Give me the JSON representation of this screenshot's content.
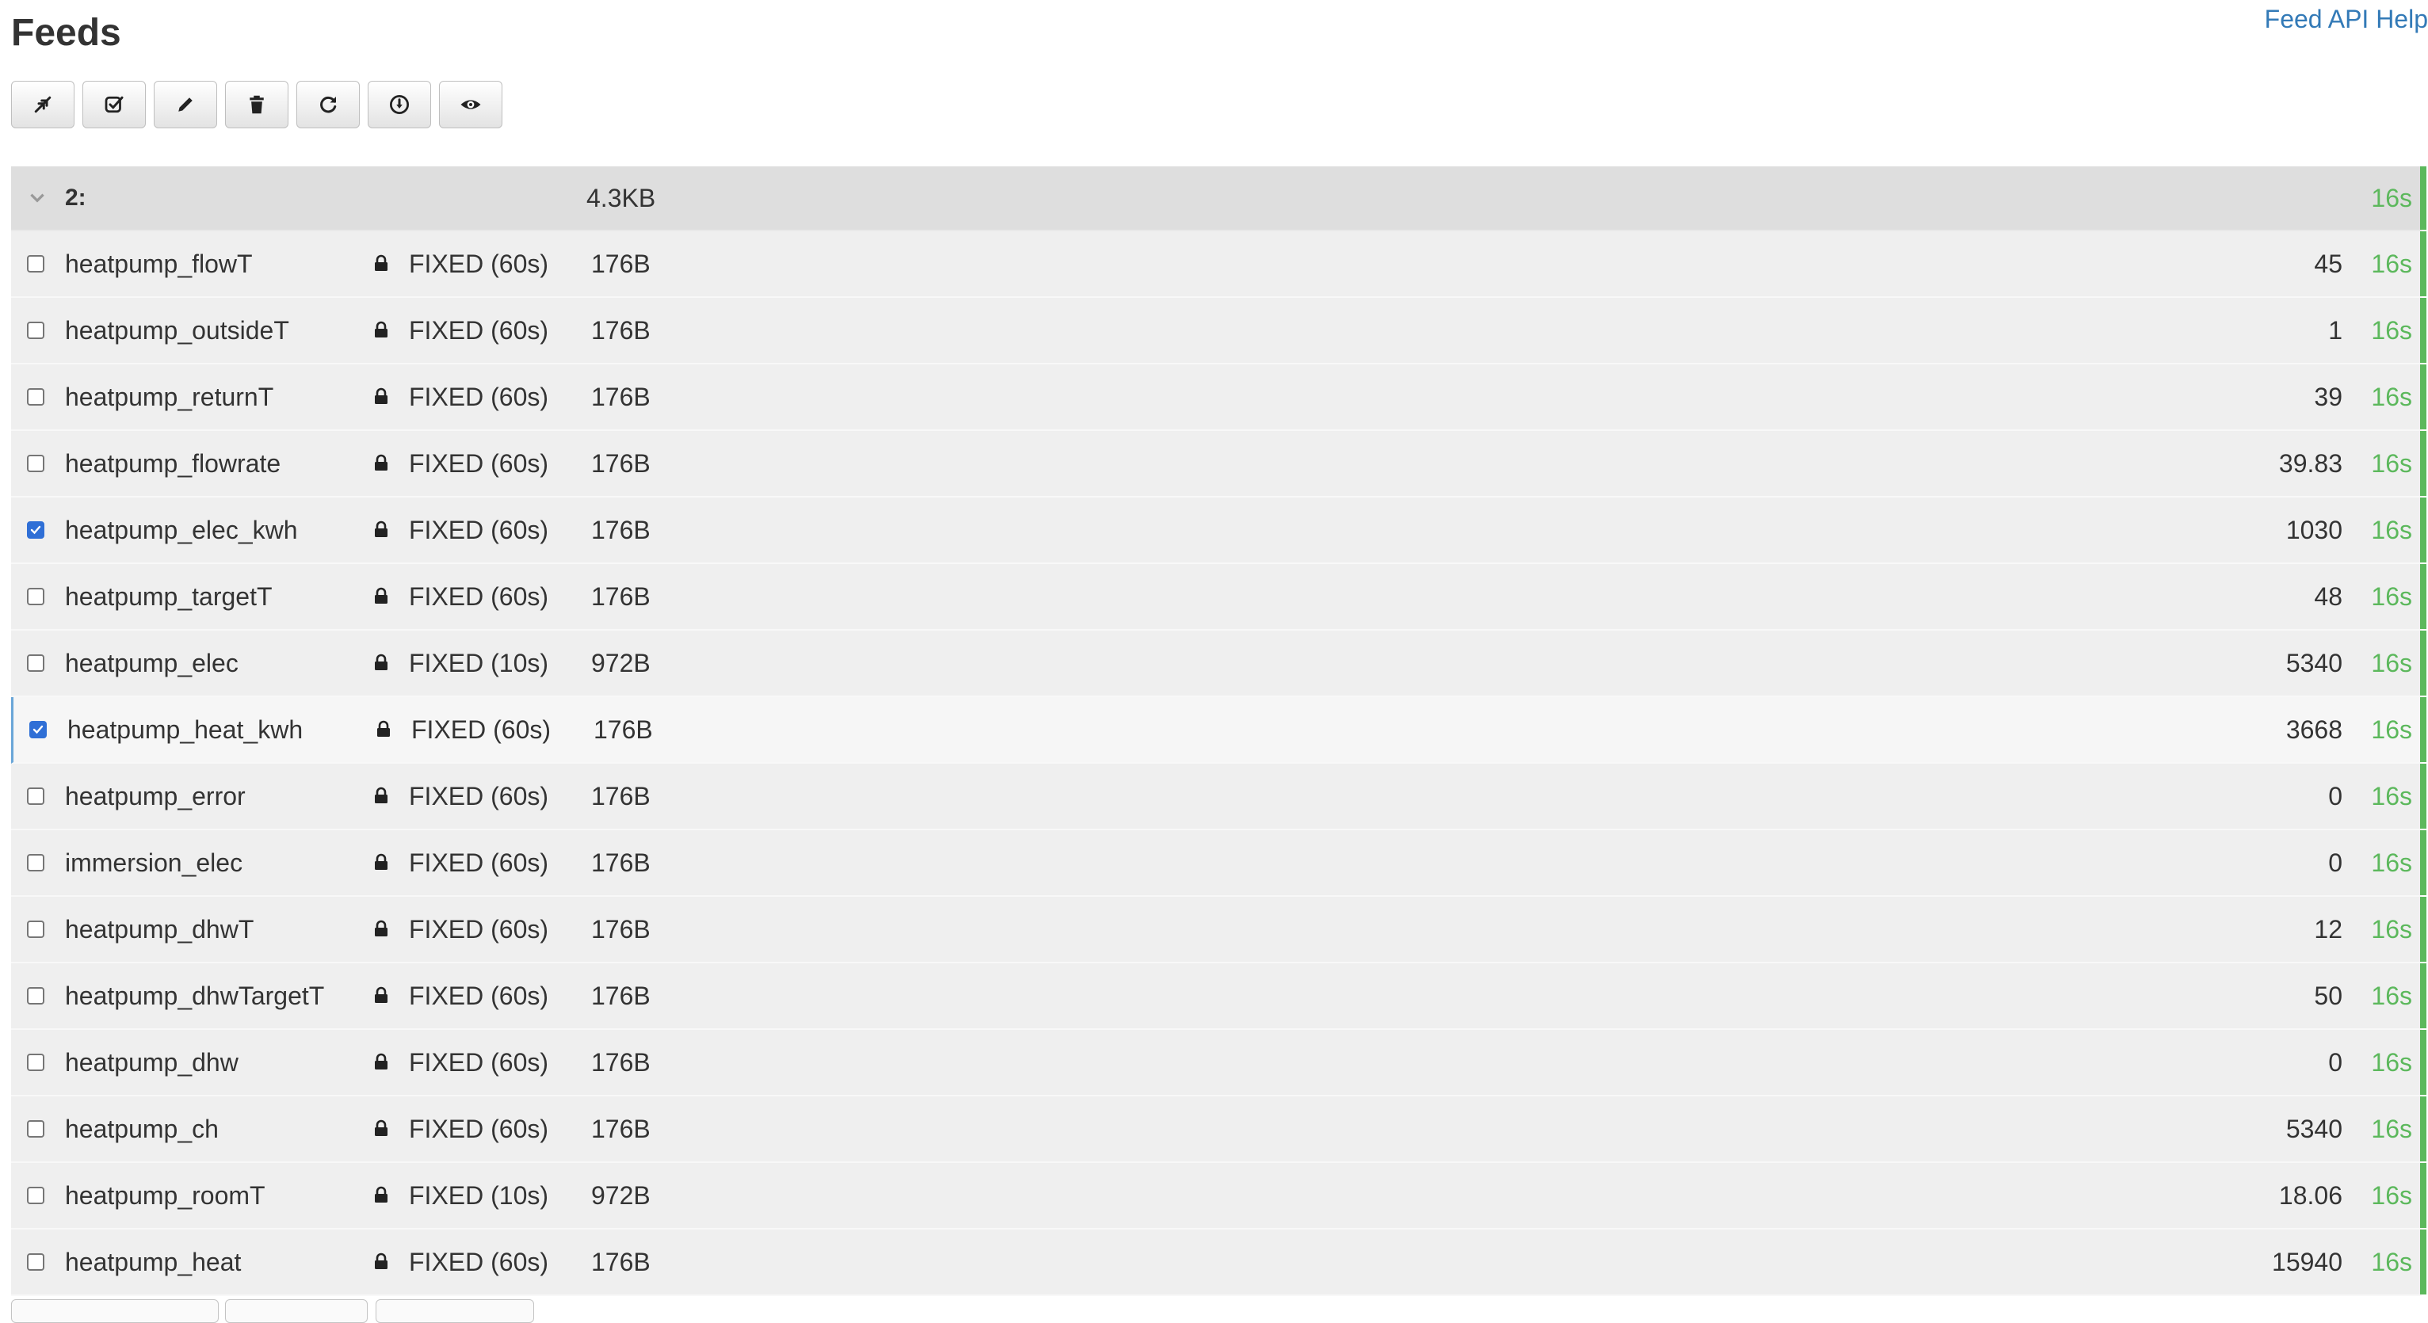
{
  "header": {
    "title": "Feeds",
    "help_link": "Feed API Help"
  },
  "toolbar": {
    "buttons": [
      {
        "icon": "collapse-icon"
      },
      {
        "icon": "select-all-icon"
      },
      {
        "icon": "pencil-icon"
      },
      {
        "icon": "trash-icon"
      },
      {
        "icon": "refresh-icon"
      },
      {
        "icon": "download-icon"
      },
      {
        "icon": "eye-icon"
      }
    ]
  },
  "group": {
    "label": "2:",
    "size": "4.3KB",
    "updated": "16s",
    "expanded": true
  },
  "feeds": [
    {
      "name": "heatpump_flowT",
      "engine": "FIXED (60s)",
      "size": "176B",
      "value": "45",
      "updated": "16s",
      "checked": false
    },
    {
      "name": "heatpump_outsideT",
      "engine": "FIXED (60s)",
      "size": "176B",
      "value": "1",
      "updated": "16s",
      "checked": false
    },
    {
      "name": "heatpump_returnT",
      "engine": "FIXED (60s)",
      "size": "176B",
      "value": "39",
      "updated": "16s",
      "checked": false
    },
    {
      "name": "heatpump_flowrate",
      "engine": "FIXED (60s)",
      "size": "176B",
      "value": "39.83",
      "updated": "16s",
      "checked": false
    },
    {
      "name": "heatpump_elec_kwh",
      "engine": "FIXED (60s)",
      "size": "176B",
      "value": "1030",
      "updated": "16s",
      "checked": true
    },
    {
      "name": "heatpump_targetT",
      "engine": "FIXED (60s)",
      "size": "176B",
      "value": "48",
      "updated": "16s",
      "checked": false
    },
    {
      "name": "heatpump_elec",
      "engine": "FIXED (10s)",
      "size": "972B",
      "value": "5340",
      "updated": "16s",
      "checked": false
    },
    {
      "name": "heatpump_heat_kwh",
      "engine": "FIXED (60s)",
      "size": "176B",
      "value": "3668",
      "updated": "16s",
      "checked": true
    },
    {
      "name": "heatpump_error",
      "engine": "FIXED (60s)",
      "size": "176B",
      "value": "0",
      "updated": "16s",
      "checked": false
    },
    {
      "name": "immersion_elec",
      "engine": "FIXED (60s)",
      "size": "176B",
      "value": "0",
      "updated": "16s",
      "checked": false
    },
    {
      "name": "heatpump_dhwT",
      "engine": "FIXED (60s)",
      "size": "176B",
      "value": "12",
      "updated": "16s",
      "checked": false
    },
    {
      "name": "heatpump_dhwTargetT",
      "engine": "FIXED (60s)",
      "size": "176B",
      "value": "50",
      "updated": "16s",
      "checked": false
    },
    {
      "name": "heatpump_dhw",
      "engine": "FIXED (60s)",
      "size": "176B",
      "value": "0",
      "updated": "16s",
      "checked": false
    },
    {
      "name": "heatpump_ch",
      "engine": "FIXED (60s)",
      "size": "176B",
      "value": "5340",
      "updated": "16s",
      "checked": false
    },
    {
      "name": "heatpump_roomT",
      "engine": "FIXED (10s)",
      "size": "972B",
      "value": "18.06",
      "updated": "16s",
      "checked": false
    },
    {
      "name": "heatpump_heat",
      "engine": "FIXED (60s)",
      "size": "176B",
      "value": "15940",
      "updated": "16s",
      "checked": false
    }
  ],
  "colors": {
    "status_green": "#5cb85c",
    "link_blue": "#337ab7",
    "checkbox_blue": "#2f6fd6"
  }
}
